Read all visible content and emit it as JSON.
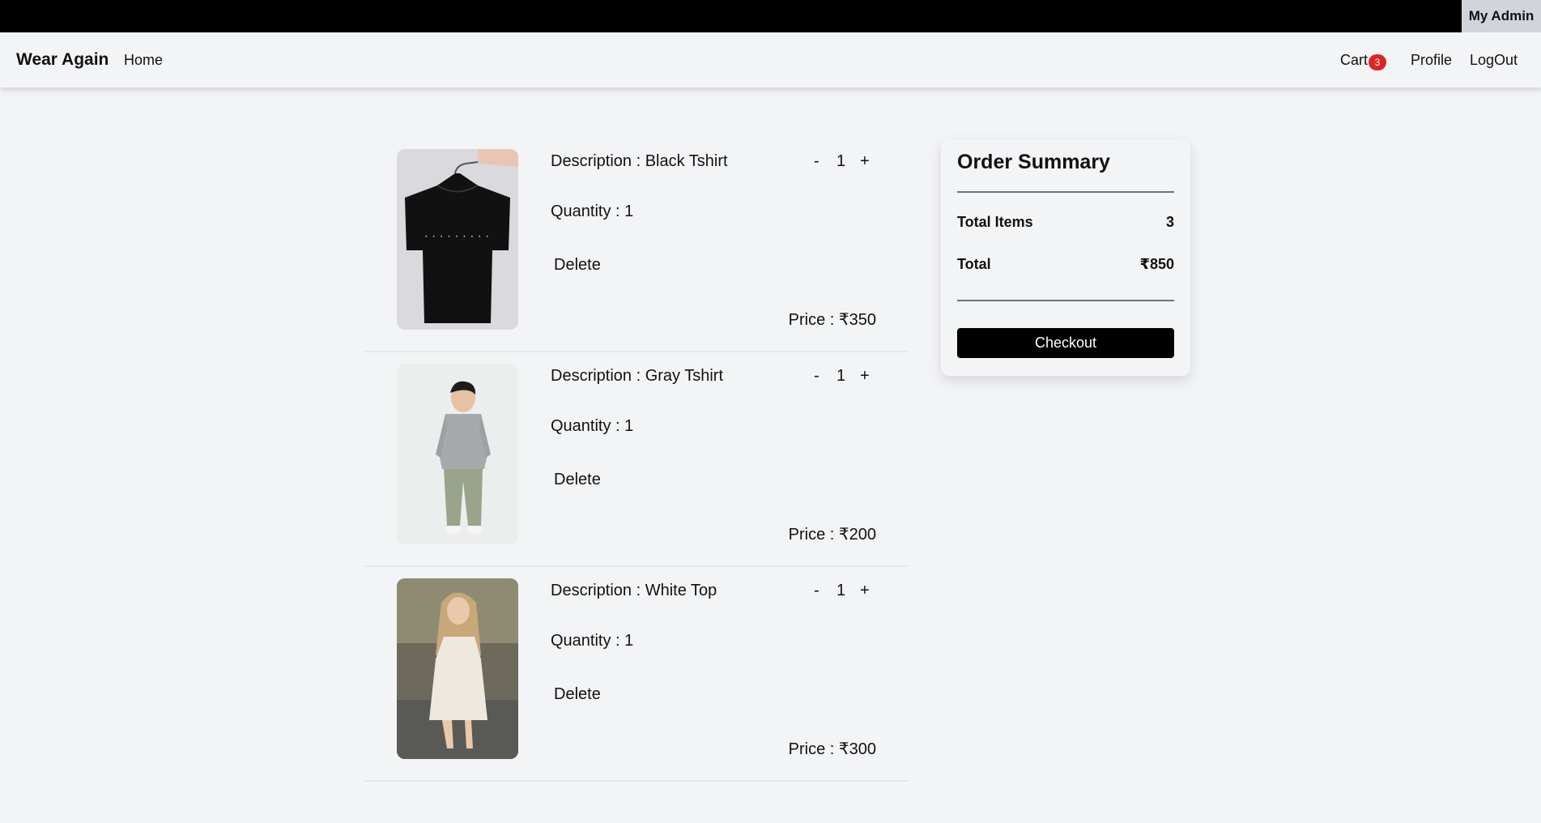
{
  "topbar": {
    "admin_label": "My Admin"
  },
  "navbar": {
    "brand": "Wear Again",
    "home": "Home",
    "cart": "Cart",
    "cart_count": "3",
    "profile": "Profile",
    "logout": "LogOut"
  },
  "cart": {
    "items": [
      {
        "description": "Description : Black Tshirt",
        "quantity_text": "Quantity : 1",
        "qty": "1",
        "minus": "-",
        "plus": "+",
        "delete": "Delete",
        "price": "Price : ₹350",
        "image": "black-tshirt-on-hanger"
      },
      {
        "description": "Description : Gray Tshirt",
        "quantity_text": "Quantity : 1",
        "qty": "1",
        "minus": "-",
        "plus": "+",
        "delete": "Delete",
        "price": "Price : ₹200",
        "image": "boy-in-gray-sweatshirt"
      },
      {
        "description": "Description : White Top",
        "quantity_text": "Quantity : 1",
        "qty": "1",
        "minus": "-",
        "plus": "+",
        "delete": "Delete",
        "price": "Price : ₹300",
        "image": "woman-in-white-dress"
      }
    ]
  },
  "summary": {
    "title": "Order Summary",
    "total_items_label": "Total Items",
    "total_items_value": "3",
    "total_label": "Total",
    "total_value": "₹850",
    "checkout": "Checkout"
  },
  "colors": {
    "badge": "#dc2626",
    "checkout_bg": "#000000",
    "page_bg": "#f3f4f6"
  }
}
